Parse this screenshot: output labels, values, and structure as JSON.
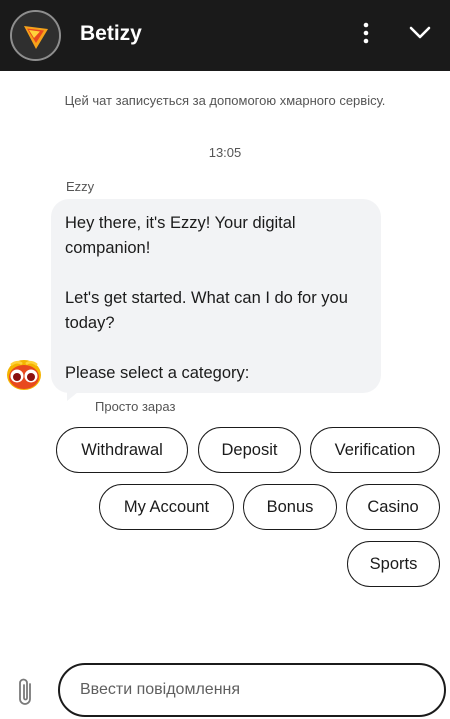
{
  "header": {
    "title": "Betizy",
    "logo_icon": "betizy-logo-icon",
    "menu_icon": "more-vertical-icon",
    "minimize_icon": "chevron-down-icon",
    "background_color": "#1a1a1a"
  },
  "notice": "Цей чат записується за допомогою хмарного сервісу.",
  "timestamp": "13:05",
  "message": {
    "sender": "Ezzy",
    "avatar_icon": "ezzy-avatar-icon",
    "lines": [
      "Hey there, it's Ezzy! Your digital companion!",
      "Let's get started. What can I do for you today?",
      "Please select a category:"
    ],
    "status": "Просто зараз"
  },
  "options": {
    "withdrawal": "Withdrawal",
    "deposit": "Deposit",
    "verification": "Verification",
    "my_account": "My Account",
    "bonus": "Bonus",
    "casino": "Casino",
    "sports": "Sports"
  },
  "composer": {
    "attach_icon": "paperclip-icon",
    "placeholder": "Ввести повідомлення"
  }
}
